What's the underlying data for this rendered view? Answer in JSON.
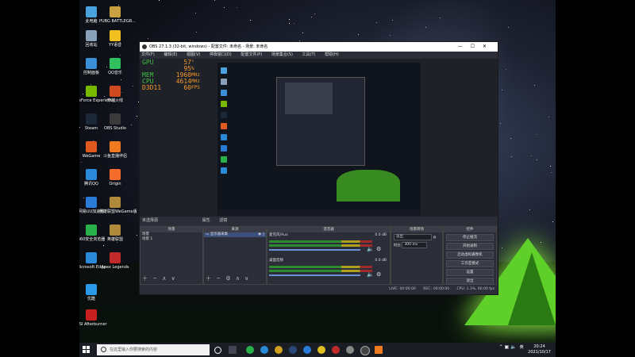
{
  "desktop": {
    "icons": [
      {
        "label": "此电脑",
        "color": "#4aa3df"
      },
      {
        "label": "PUBG BATTLEGR...",
        "color": "#c8a040"
      },
      {
        "label": "回收站",
        "color": "#8aa0b8"
      },
      {
        "label": "YY语音",
        "color": "#f0c020"
      },
      {
        "label": "控制面板",
        "color": "#3b8fd6"
      },
      {
        "label": "QQ音乐",
        "color": "#2fbf5f"
      },
      {
        "label": "GeForce Experience",
        "color": "#76b900"
      },
      {
        "label": "穿越火线",
        "color": "#d04a20"
      },
      {
        "label": "Steam",
        "color": "#1b2838"
      },
      {
        "label": "OBS Studio",
        "color": "#3a3a3a"
      },
      {
        "label": "WeGame",
        "color": "#e05a20"
      },
      {
        "label": "斗鱼直播伴侣",
        "color": "#f07a20"
      },
      {
        "label": "腾讯QQ",
        "color": "#2a8ad8"
      },
      {
        "label": "Origin",
        "color": "#f56c2d"
      },
      {
        "label": "网易UU加速器",
        "color": "#2a7ad8"
      },
      {
        "label": "英雄联盟WeGame版",
        "color": "#b08a3a"
      },
      {
        "label": "360安全浏览器",
        "color": "#2ab04a"
      },
      {
        "label": "英雄联盟",
        "color": "#b08a3a"
      },
      {
        "label": "Microsoft Edge",
        "color": "#2a8ad8"
      },
      {
        "label": "Apex Legends",
        "color": "#c02a2a"
      },
      {
        "label": "优酷",
        "color": "#2a9ae8"
      },
      {
        "label": "MSI Afterburner",
        "color": "#c82020"
      }
    ]
  },
  "obs": {
    "title": "OBS 27.1.3 (32-bit, windows) - 配置文件: 未命名 - 场景: 未命名",
    "window_controls": [
      "—",
      "☐",
      "✕"
    ],
    "menu": [
      "文件(F)",
      "编辑(E)",
      "视图(V)",
      "停靠窗口(D)",
      "配置文件(P)",
      "场景集合(S)",
      "工具(T)",
      "帮助(H)"
    ],
    "overlay_stats": [
      {
        "key": "GPU",
        "value": "57",
        "unit": "°",
        "color": "#3fbf3f"
      },
      {
        "key": "",
        "value": "95",
        "unit": "%",
        "color": "#3fbf3f"
      },
      {
        "key": "MEM",
        "value": "1960",
        "unit": "MHz",
        "color": "#3fbf3f"
      },
      {
        "key": "CPU",
        "value": "4614",
        "unit": "MHz",
        "color": "#3fbf3f"
      },
      {
        "key": "D3D11",
        "value": "60",
        "unit": "FPS",
        "color": "#f29a2e"
      }
    ],
    "tabbar": {
      "no_source": "未选择源",
      "properties": "属性",
      "filters": "滤镜"
    },
    "scenes": {
      "header": "场景",
      "items": [
        "场景",
        "场景 1"
      ]
    },
    "sources": {
      "header": "来源",
      "items": [
        "显示器采集"
      ]
    },
    "mixer": {
      "header": "混音器",
      "channels": [
        {
          "name": "麦克风/Aux",
          "level": "0.0 dB"
        },
        {
          "name": "桌面音频",
          "level": "0.0 dB"
        }
      ]
    },
    "transitions": {
      "header": "场景转场",
      "type": "淡出",
      "duration_label": "时长",
      "duration": "300 ms"
    },
    "controls": {
      "header": "控件",
      "buttons": [
        "停止推流",
        "开始录制",
        "启动虚拟摄像机",
        "工作室模式",
        "设置",
        "退出"
      ]
    },
    "status": {
      "live": "LIVE:",
      "live_time": "00:00:00",
      "rec": "REC:",
      "rec_time": "00:00:00",
      "cpu": "CPU: 1.3%, 60.00 fps"
    }
  },
  "taskbar": {
    "search_placeholder": "在这里输入你要搜索的内容",
    "time": "20:24",
    "date": "2021/10/17",
    "lang": "英"
  }
}
